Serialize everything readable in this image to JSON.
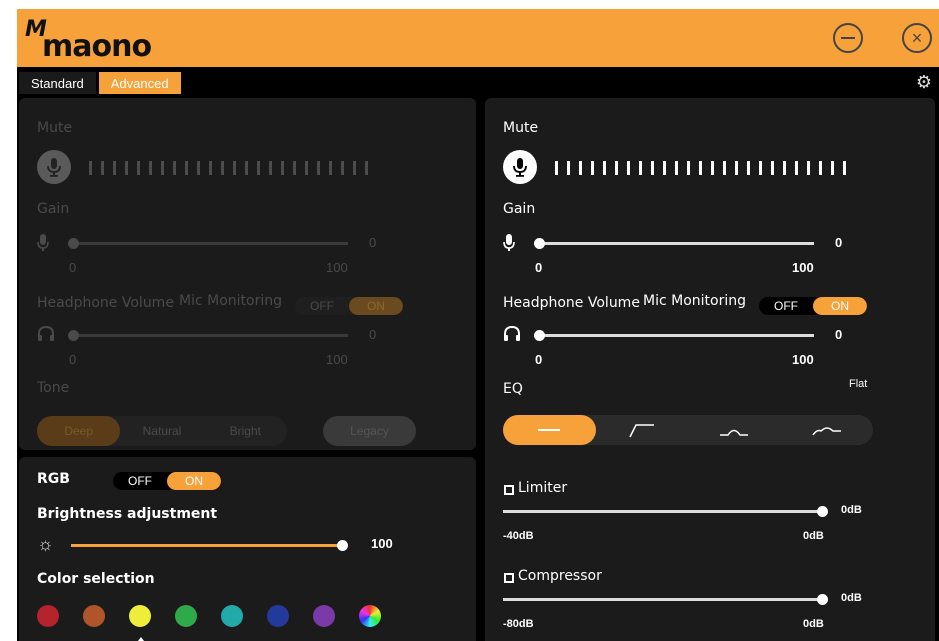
{
  "app": {
    "logo_text": "maono",
    "logo_mark": "M"
  },
  "tabs": [
    {
      "label": "Standard"
    },
    {
      "label": "Advanced"
    }
  ],
  "left_panel": {
    "mute_label": "Mute",
    "gain_label": "Gain",
    "gain_value": "0",
    "gain_min": "0",
    "gain_max": "100",
    "headphone_label": "Headphone Volume",
    "mic_monitoring_label": "Mic Monitoring",
    "toggle_off": "OFF",
    "toggle_on": "ON",
    "hp_value": "0",
    "hp_min": "0",
    "hp_max": "100",
    "tone_label": "Tone",
    "tone_options": [
      "Deep",
      "Natural",
      "Bright"
    ],
    "legacy_label": "Legacy"
  },
  "rgb_panel": {
    "rgb_label": "RGB",
    "toggle_off": "OFF",
    "toggle_on": "ON",
    "brightness_label": "Brightness adjustment",
    "brightness_value": "100",
    "color_label": "Color selection",
    "colors": [
      "#b3242c",
      "#b0542c",
      "#eeee3a",
      "#2eaa4a",
      "#22aaaa",
      "#243a9a",
      "#7a3aa8",
      "rainbow"
    ]
  },
  "right_panel": {
    "mute_label": "Mute",
    "gain_label": "Gain",
    "gain_value": "0",
    "gain_min": "0",
    "gain_max": "100",
    "headphone_label": "Headphone Volume",
    "mic_monitoring_label": "Mic Monitoring",
    "toggle_off": "OFF",
    "toggle_on": "ON",
    "hp_value": "0",
    "hp_min": "0",
    "hp_max": "100",
    "eq_label": "EQ",
    "eq_preset": "Flat",
    "limiter_label": "Limiter",
    "limiter_value": "0dB",
    "limiter_min": "-40dB",
    "limiter_max": "0dB",
    "compressor_label": "Compressor",
    "compressor_value": "0dB",
    "compressor_min": "-80dB",
    "compressor_max": "0dB"
  },
  "icons": {
    "minimize": "minus-circle-icon",
    "close": "x-circle-icon",
    "settings": "gear-icon",
    "mic": "microphone-icon",
    "headphones": "headphones-icon",
    "sun": "sun-icon"
  }
}
